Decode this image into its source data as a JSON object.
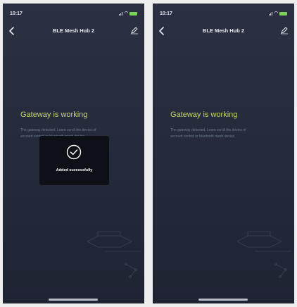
{
  "colors": {
    "screen_bg": "#262c3c",
    "headline": "#c7d36a",
    "battery": "#7dd35a",
    "toast_bg": "#0c0e14",
    "home_indicator": "#b8bdc8"
  },
  "screens": [
    {
      "status": {
        "time": "10:17"
      },
      "nav": {
        "title": "BLE Mesh Hub 2",
        "back_icon": "chevron-left-icon",
        "edit_icon": "pencil-icon"
      },
      "headline": "Gateway is working",
      "description": {
        "line1": "The gateway detected. Learn scroll the device of",
        "line2": "account control or bluetooth mesh device."
      },
      "toast": {
        "icon": "check-circle-icon",
        "text": "Added successfully"
      }
    },
    {
      "status": {
        "time": "10:17"
      },
      "nav": {
        "title": "BLE Mesh Hub 2",
        "back_icon": "chevron-left-icon",
        "edit_icon": "pencil-icon"
      },
      "headline": "Gateway is working",
      "description": {
        "line1": "The gateway detected. Learn scroll the device of",
        "line2": "account control or bluetooth mesh device."
      }
    }
  ]
}
